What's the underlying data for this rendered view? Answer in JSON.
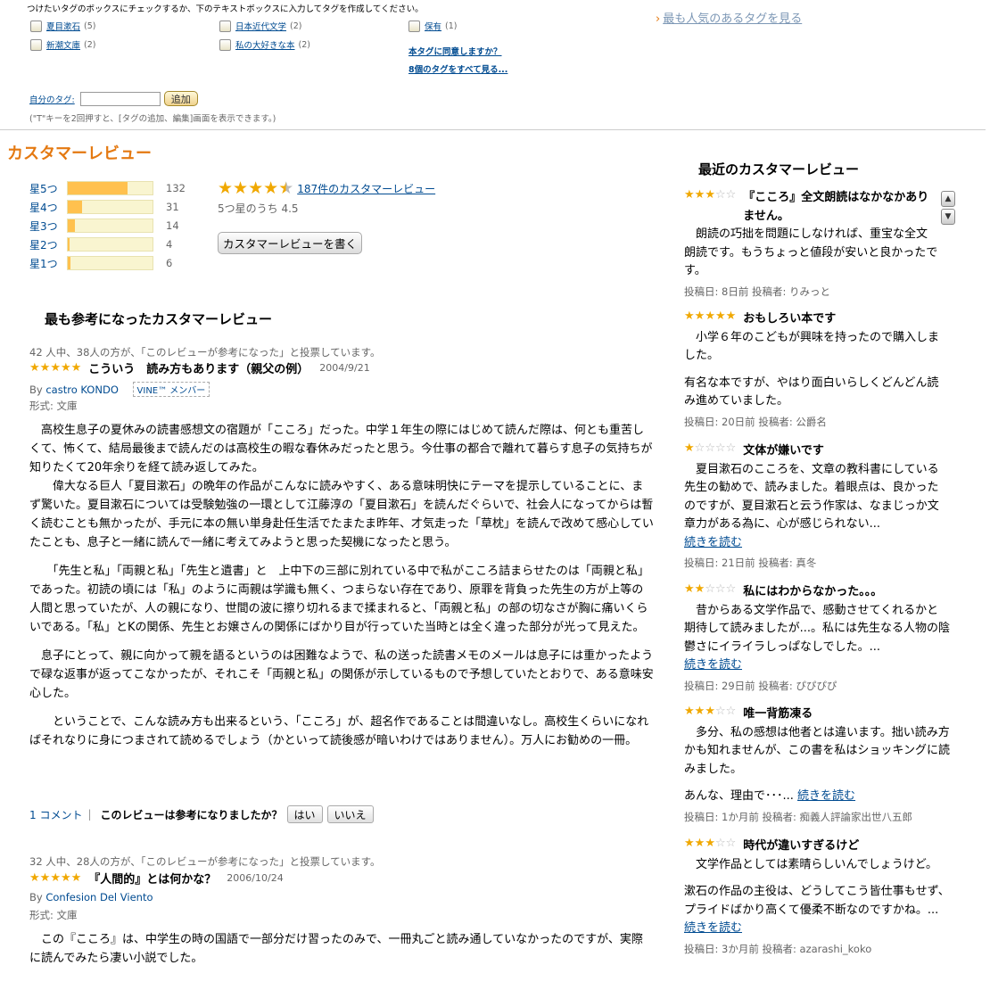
{
  "tags": {
    "hint": "つけたいタグのボックスにチェックするか、下のテキストボックスに入力してタグを作成してください。",
    "items": [
      {
        "label": "夏目漱石",
        "count": "(5)"
      },
      {
        "label": "日本近代文学",
        "count": "(2)"
      },
      {
        "label": "保有",
        "count": "(1)"
      },
      {
        "label": "新潮文庫",
        "count": "(2)"
      },
      {
        "label": "私の大好きな本",
        "count": "(2)"
      }
    ],
    "popular": "最も人気のあるタグを見る",
    "agree": "本タグに同意しますか？",
    "see_all": "8個のタグをすべて見る...",
    "my_tag_label": "自分のタグ:",
    "my_tag_value": "",
    "add_button": "追加",
    "note": "(\"T\"キーを2回押すと、[タグの追加、編集]画面を表示できます。)"
  },
  "customer_reviews": {
    "title": "カスタマーレビュー",
    "histogram": [
      {
        "label": "星5つ",
        "count": "132",
        "fraction": 0.71
      },
      {
        "label": "星4つ",
        "count": "31",
        "fraction": 0.17
      },
      {
        "label": "星3つ",
        "count": "14",
        "fraction": 0.08
      },
      {
        "label": "星2つ",
        "count": "4",
        "fraction": 0.02
      },
      {
        "label": "星1つ",
        "count": "6",
        "fraction": 0.03
      }
    ],
    "rating": 4.5,
    "review_count": "187件のカスタマーレビュー",
    "average": "5つ星のうち 4.5",
    "write_button": "カスタマーレビューを書く"
  },
  "most_helpful": {
    "title": "最も参考になったカスタマーレビュー",
    "reviews": [
      {
        "helpful": "42 人中、38人の方が、「このレビューが参考になった」と投票しています。",
        "rating": 5,
        "title": "こういう　読み方もあります（親父の例）",
        "date": "2004/9/21",
        "by_prefix": "By",
        "author": "castro KONDO",
        "badge": "VINE™ メンバー",
        "format": "形式: 文庫",
        "paragraphs": [
          "　高校生息子の夏休みの読書感想文の宿題が「こころ」だった。中学１年生の際にはじめて読んだ際は、何とも重苦しくて、怖くて、結局最後まで読んだのは高校生の暇な春休みだったと思う。今仕事の都合で離れて暮らす息子の気持ちが知りたくて20年余りを経て読み返してみた。",
          "　　偉大なる巨人「夏目漱石」の晩年の作品がこんなに読みやすく、ある意味明快にテーマを提示していることに、まず驚いた。夏目漱石については受験勉強の一環として江藤淳の「夏目漱石」を読んだぐらいで、社会人になってからは暫く読むことも無かったが、手元に本の無い単身赴任生活でたまたま昨年、才気走った「草枕」を読んで改めて感心していたことも、息子と一緒に読んで一緒に考えてみようと思った契機になったと思う。",
          "　　「先生と私」「両親と私」「先生と遺書」と　上中下の三部に別れている中で私がこころ詰まらせたのは「両親と私」であった。初読の頃には「私」のように両親は学識も無く、つまらない存在であり、原罪を背負った先生の方が上等の人間と思っていたが、人の親になり、世間の波に擦り切れるまで揉まれると、「両親と私」の部の切なさが胸に痛いくらいである。「私」とKの関係、先生とお嬢さんの関係にばかり目が行っていた当時とは全く違った部分が光って見えた。",
          "　息子にとって、親に向かって親を語るというのは困難なようで、私の送った読書メモのメールは息子には重かったようで碌な返事が返ってこなかったが、それこそ「両親と私」の関係が示しているもので予想していたとおりで、ある意味安心した。",
          "　　ということで、こんな読み方も出来るという、「こころ」が、超名作であることは間違いなし。高校生くらいになればそれなりに身につまされて読めるでしょう（かといって読後感が暗いわけではありません）。万人にお勧めの一冊。"
        ],
        "comments": "1 コメント",
        "separator": "|",
        "question": "このレビューは参考になりましたか？",
        "yes": "はい",
        "no": "いいえ"
      },
      {
        "helpful": "32 人中、28人の方が、「このレビューが参考になった」と投票しています。",
        "rating": 5,
        "title": "『人間的』とは何かな？",
        "date": "2006/10/24",
        "by_prefix": "By",
        "author": "Confesion Del Viento",
        "format": "形式: 文庫",
        "paragraphs": [
          "　この『こころ』は、中学生の時の国語で一部分だけ習ったのみで、一冊丸ごと読み通していなかったのですが、実際に読んでみたら凄い小説でした。"
        ]
      }
    ]
  },
  "recent": {
    "title": "最近のカスタマーレビュー",
    "reviews": [
      {
        "rating": 3,
        "title": "『こころ』全文朗読はなかなかありません。",
        "body": "　朗読の巧拙を問題にしなければ、重宝な全文朗読です。もうちょっと値段が安いと良かったです。",
        "meta": "投稿日: 8日前 投稿者: りみっと"
      },
      {
        "rating": 5,
        "title": "おもしろい本です",
        "body": "　小学６年のこどもが興味を持ったので購入しました。",
        "body2": "有名な本ですが、やはり面白いらしくどんどん読み進めていました。",
        "meta": "投稿日: 20日前 投稿者: 公爵名"
      },
      {
        "rating": 1,
        "title": "文体が嫌いです",
        "body": "　夏目漱石のこころを、文章の教科書にしている先生の勧めで、読みました。着眼点は、良かったのですが、夏目漱石と云う作家は、なまじっか文章力がある為に、心が感じられない...",
        "more": "続きを読む",
        "meta": "投稿日: 21日前 投稿者: 真冬"
      },
      {
        "rating": 2,
        "title": "私にはわからなかった。。。",
        "body": "　昔からある文学作品で、感動させてくれるかと期待して読みましたが...。私には先生なる人物の陰鬱さにイライラしっぱなしでした。...",
        "more": "続きを読む",
        "meta": "投稿日: 29日前 投稿者: ぴぴぴぴ"
      },
      {
        "rating": 3,
        "title": "唯一背筋凍る",
        "body": "　多分、私の感想は他者とは違います。拙い読み方かも知れませんが、この書を私はショッキングに読みました。",
        "body2": "あんな、理由で･･･...",
        "more": "続きを読む",
        "meta": "投稿日: 1か月前 投稿者: 痴義人評論家出世八五郎"
      },
      {
        "rating": 3,
        "title": "時代が違いすぎるけど",
        "body": "　文学作品としては素晴らしいんでしょうけど。",
        "body2": "漱石の作品の主役は、どうしてこう皆仕事もせず、プライドばかり高くて優柔不断なのですかね。...",
        "more": "続きを読む",
        "meta": "投稿日: 3か月前 投稿者: azarashi_koko"
      }
    ]
  },
  "colors": {
    "star": "#f0a800",
    "star_empty": "#bbbbbb",
    "accent": "#e47911",
    "link": "#004b91"
  },
  "icons": {
    "scroll_up": "▲",
    "scroll_down": "▼",
    "popular_arrow": "›"
  }
}
